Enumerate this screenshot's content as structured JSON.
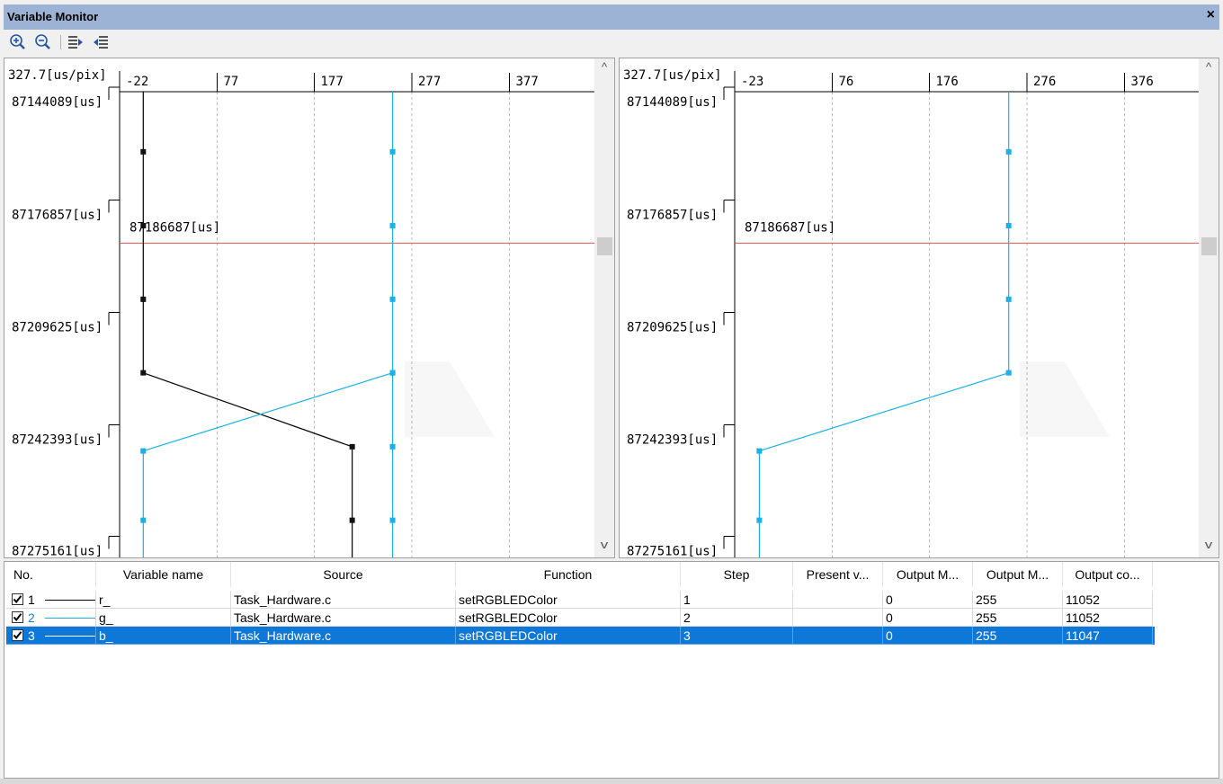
{
  "window": {
    "title": "Variable Monitor",
    "close_glyph": "×"
  },
  "toolbar": {
    "buttons": [
      "zoom-in-icon",
      "zoom-out-icon",
      "expand-rows-icon",
      "collapse-rows-icon"
    ]
  },
  "colors": {
    "series_r": "#000000",
    "series_g": "#1ab0e8",
    "series_b": "#1ab0e8",
    "cursor": "#e05050",
    "selection": "#0e78d8"
  },
  "scroll": {
    "up": "^",
    "down": "v"
  },
  "panes": [
    {
      "scale": "327.7[us/pix]",
      "x_ticks": [
        "-22",
        "77",
        "177",
        "277",
        "377"
      ],
      "y_ticks": [
        "87144089[us]",
        "87176857[us]",
        "87209625[us]",
        "87242393[us]",
        "87275161[us]"
      ],
      "cursor_label": "87186687[us]"
    },
    {
      "scale": "327.7[us/pix]",
      "x_ticks": [
        "-23",
        "76",
        "176",
        "276",
        "376"
      ],
      "y_ticks": [
        "87144089[us]",
        "87176857[us]",
        "87209625[us]",
        "87242393[us]",
        "87275161[us]"
      ],
      "cursor_label": "87186687[us]"
    }
  ],
  "chart_data": [
    {
      "type": "line",
      "title": "",
      "x_axis": "value",
      "y_axis": "time [us]",
      "x_range": [
        -22,
        460
      ],
      "y_range": [
        87144089,
        87275161
      ],
      "cursor_time": 87186687,
      "series": [
        {
          "name": "r_",
          "color": "#000000",
          "points": [
            [
              2,
              87144089
            ],
            [
              2,
              87161000
            ],
            [
              2,
              87181800
            ],
            [
              2,
              87202500
            ],
            [
              2,
              87223200
            ],
            [
              214,
              87244000
            ],
            [
              214,
              87264700
            ],
            [
              214,
              87275161
            ]
          ]
        },
        {
          "name": "b_",
          "color": "#1ab0e8",
          "points": [
            [
              255,
              87144089
            ],
            [
              255,
              87161000
            ],
            [
              255,
              87181800
            ],
            [
              255,
              87202500
            ],
            [
              255,
              87223200
            ],
            [
              255,
              87244000
            ],
            [
              255,
              87264700
            ],
            [
              255,
              87275161
            ]
          ]
        },
        {
          "name": "g_",
          "color": "#1ab0e8",
          "points": [
            [
              255,
              87223200
            ],
            [
              2,
              87245200
            ],
            [
              2,
              87264700
            ],
            [
              2,
              87275161
            ]
          ]
        }
      ]
    },
    {
      "type": "line",
      "title": "",
      "x_axis": "value",
      "y_axis": "time [us]",
      "x_range": [
        -23,
        460
      ],
      "y_range": [
        87144089,
        87275161
      ],
      "cursor_time": 87186687,
      "series": [
        {
          "name": "b_",
          "color": "#1ab0e8",
          "points": [
            [
              255,
              87144089
            ],
            [
              255,
              87161000
            ],
            [
              255,
              87181800
            ],
            [
              255,
              87202500
            ],
            [
              255,
              87223200
            ],
            [
              2,
              87245200
            ],
            [
              2,
              87264700
            ],
            [
              2,
              87275161
            ]
          ]
        }
      ]
    }
  ],
  "table": {
    "columns": [
      "No.",
      "Variable name",
      "Source",
      "Function",
      "Step",
      "Present v...",
      "Output M...",
      "Output M...",
      "Output co..."
    ],
    "rows": [
      {
        "no": "1",
        "name": "r_",
        "source": "Task_Hardware.c",
        "function": "setRGBLEDColor",
        "step": "1",
        "present": "",
        "out_min": "0",
        "out_max": "255",
        "out_count": "11052",
        "line_color": "#000000",
        "checked": true,
        "selected": false
      },
      {
        "no": "2",
        "name": "g_",
        "source": "Task_Hardware.c",
        "function": "setRGBLEDColor",
        "step": "2",
        "present": "",
        "out_min": "0",
        "out_max": "255",
        "out_count": "11052",
        "line_color": "#1ab0e8",
        "checked": true,
        "selected": false
      },
      {
        "no": "3",
        "name": "b_",
        "source": "Task_Hardware.c",
        "function": "setRGBLEDColor",
        "step": "3",
        "present": "",
        "out_min": "0",
        "out_max": "255",
        "out_count": "11047",
        "line_color": "#1ab0e8",
        "checked": true,
        "selected": true
      }
    ]
  }
}
